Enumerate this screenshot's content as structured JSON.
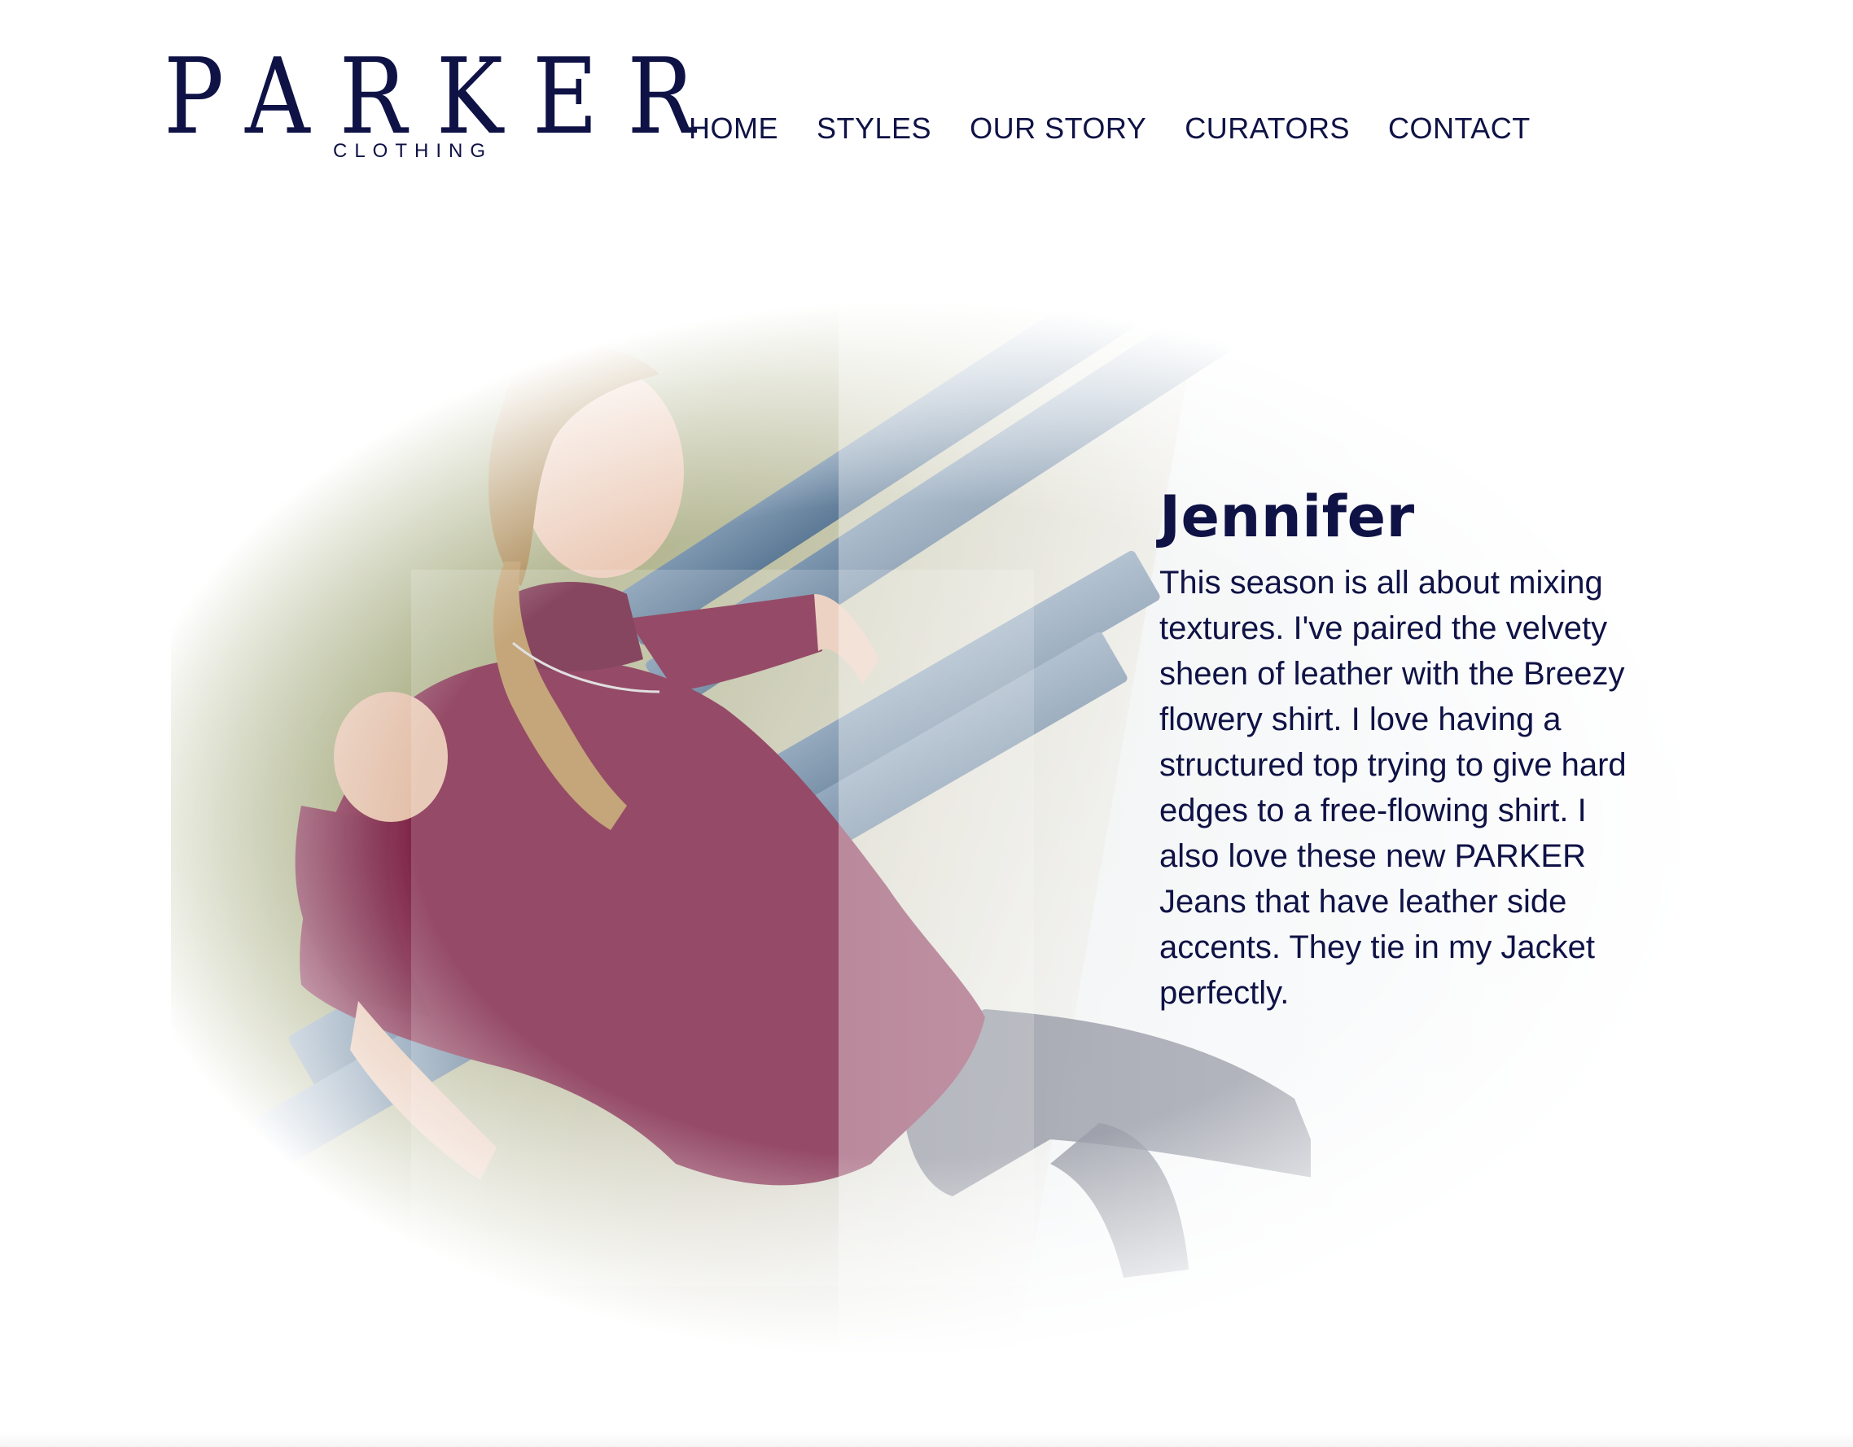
{
  "brand": {
    "name": "PARKER",
    "subtitle": "CLOTHING"
  },
  "nav": {
    "items": [
      {
        "label": "HOME"
      },
      {
        "label": "STYLES"
      },
      {
        "label": "OUR STORY"
      },
      {
        "label": "CURATORS"
      },
      {
        "label": "CONTACT"
      }
    ]
  },
  "curator": {
    "name": "Jennifer",
    "quote": "This season is all about mixing textures. I've paired the velvety sheen of leather with the Breezy flowery shirt. I love having a structured top trying to give hard edges to a free-flowing shirt. I also love these new PARKER Jeans that have leather side accents. They tie in my Jacket perfectly."
  },
  "colors": {
    "brand_navy": "#0f1245",
    "sweater": "#7e2446",
    "bench": "#5d7a96",
    "background": "#ffffff"
  }
}
